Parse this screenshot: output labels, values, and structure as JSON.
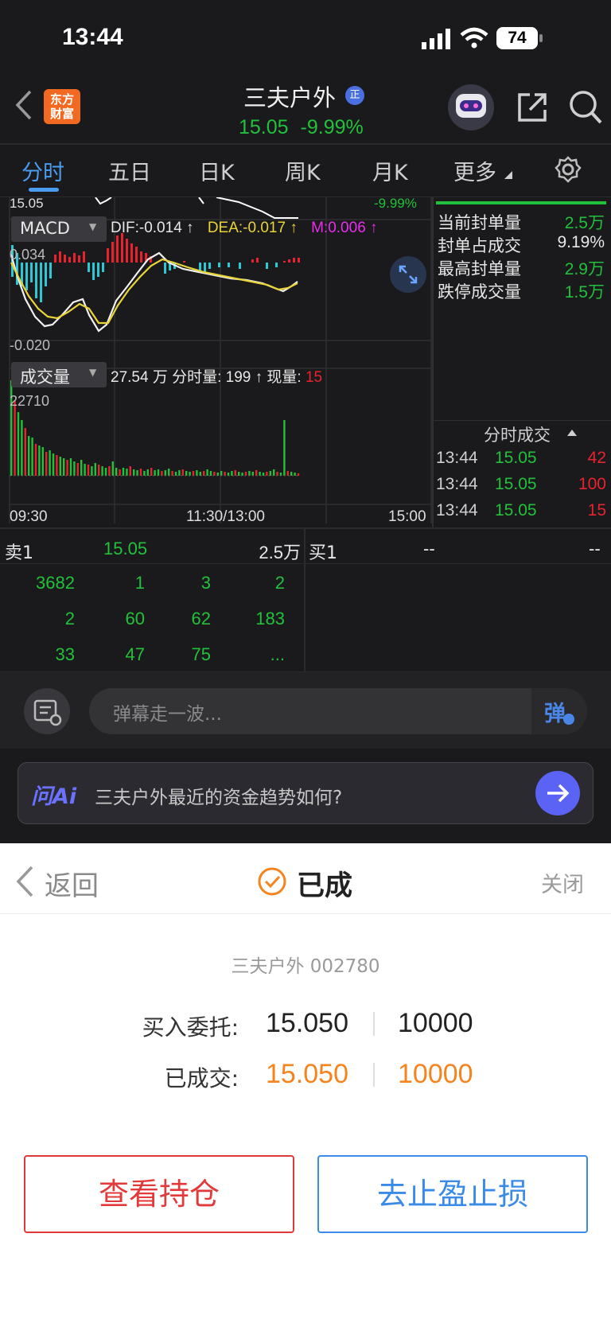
{
  "status_bar": {
    "time": "13:44",
    "battery": "74"
  },
  "header": {
    "stock_name": "三夫户外",
    "price": "15.05",
    "change": "-9.99%",
    "logo_line1": "东方",
    "logo_line2": "财富",
    "cert_badge": "正"
  },
  "tabs": [
    "分时",
    "五日",
    "日K",
    "周K",
    "月K",
    "更多"
  ],
  "chart_top": {
    "left_price": "15.05",
    "right_pct": "-9.99%"
  },
  "macd": {
    "label": "MACD",
    "dif": "DIF:-0.014 ↑",
    "dea": "DEA:-0.017 ↑",
    "m": "M:0.006 ↑",
    "ymax": "0.034",
    "ymin": "-0.020"
  },
  "volume": {
    "label": "成交量",
    "summary": "27.54 万 分时量: 199 ↑ 现量:",
    "current": "15",
    "ymax": "22710",
    "x_start": "09:30",
    "x_mid": "11:30/13:00",
    "x_end": "15:00"
  },
  "right_panel": {
    "rows": [
      {
        "label": "当前封单量",
        "value": "2.5万"
      },
      {
        "label": "封单占成交",
        "value": "9.19%"
      },
      {
        "label": "最高封单量",
        "value": "2.9万"
      },
      {
        "label": "跌停成交量",
        "value": "1.5万"
      }
    ],
    "ticks_title": "分时成交",
    "ticks": [
      {
        "time": "13:44",
        "price": "15.05",
        "vol": "42"
      },
      {
        "time": "13:44",
        "price": "15.05",
        "vol": "100"
      },
      {
        "time": "13:44",
        "price": "15.05",
        "vol": "15"
      }
    ]
  },
  "orderbook": {
    "sell_label": "卖1",
    "sell_price": "15.05",
    "sell_vol": "2.5万",
    "buy_label": "买1",
    "buy_price": "--",
    "buy_vol": "--",
    "rows": [
      [
        "3682",
        "1",
        "3",
        "2"
      ],
      [
        "2",
        "60",
        "62",
        "183"
      ],
      [
        "33",
        "47",
        "75",
        "..."
      ]
    ]
  },
  "danmu": {
    "placeholder": "弹幕走一波...",
    "send": "弹"
  },
  "ai": {
    "logo": "问Ai",
    "question": "三夫户外最近的资金趋势如何?"
  },
  "sheet": {
    "back": "返回",
    "status": "已成",
    "close": "关闭",
    "stock": "三夫户外 002780",
    "entrust_label": "买入委托:",
    "entrust_price": "15.050",
    "entrust_qty": "10000",
    "filled_label": "已成交:",
    "filled_price": "15.050",
    "filled_qty": "10000",
    "btn_position": "查看持仓",
    "btn_stop": "去止盈止损"
  },
  "colors": {
    "up": "#e8232e",
    "down": "#22c13b",
    "accent": "#4a90e2",
    "orange": "#f5841f"
  }
}
